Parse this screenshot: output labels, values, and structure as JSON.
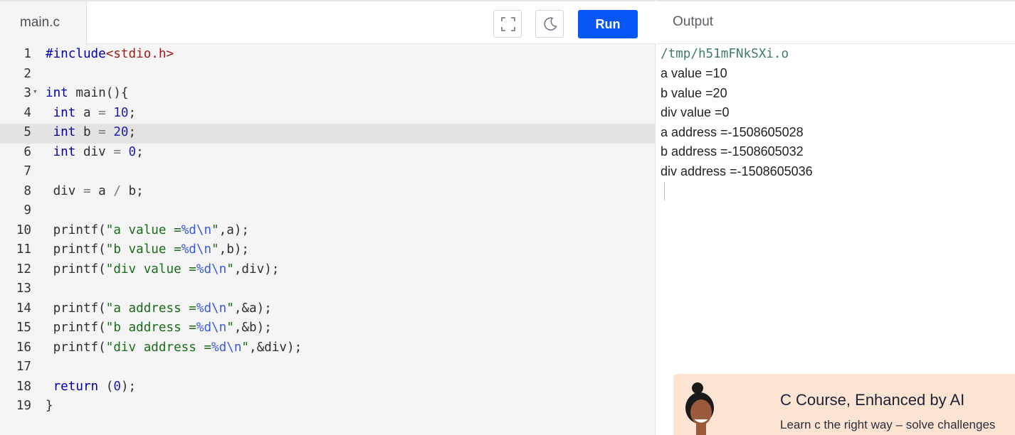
{
  "editor": {
    "file_tab": "main.c",
    "run_label": "Run",
    "active_line": 5,
    "lines": [
      {
        "n": "1",
        "segments": [
          {
            "t": "#include",
            "c": "kw"
          },
          {
            "t": "<stdio.h>",
            "c": "inc"
          }
        ]
      },
      {
        "n": "2",
        "segments": []
      },
      {
        "n": "3",
        "fold": true,
        "segments": [
          {
            "t": "int",
            "c": "kw"
          },
          {
            "t": " main(){",
            "c": ""
          }
        ]
      },
      {
        "n": "4",
        "segments": [
          {
            "t": " ",
            "c": ""
          },
          {
            "t": "int",
            "c": "kw"
          },
          {
            "t": " a ",
            "c": ""
          },
          {
            "t": "=",
            "c": "op"
          },
          {
            "t": " ",
            "c": ""
          },
          {
            "t": "10",
            "c": "num"
          },
          {
            "t": ";",
            "c": ""
          }
        ]
      },
      {
        "n": "5",
        "segments": [
          {
            "t": " ",
            "c": ""
          },
          {
            "t": "int",
            "c": "kw"
          },
          {
            "t": " b ",
            "c": ""
          },
          {
            "t": "=",
            "c": "op"
          },
          {
            "t": " ",
            "c": ""
          },
          {
            "t": "20",
            "c": "num"
          },
          {
            "t": ";",
            "c": ""
          }
        ]
      },
      {
        "n": "6",
        "segments": [
          {
            "t": " ",
            "c": ""
          },
          {
            "t": "int",
            "c": "kw"
          },
          {
            "t": " div ",
            "c": ""
          },
          {
            "t": "=",
            "c": "op"
          },
          {
            "t": " ",
            "c": ""
          },
          {
            "t": "0",
            "c": "num"
          },
          {
            "t": ";",
            "c": ""
          }
        ]
      },
      {
        "n": "7",
        "segments": []
      },
      {
        "n": "8",
        "segments": [
          {
            "t": " div ",
            "c": ""
          },
          {
            "t": "=",
            "c": "op"
          },
          {
            "t": " a ",
            "c": ""
          },
          {
            "t": "/",
            "c": "op"
          },
          {
            "t": " b;",
            "c": ""
          }
        ]
      },
      {
        "n": "9",
        "segments": []
      },
      {
        "n": "10",
        "segments": [
          {
            "t": " printf(",
            "c": ""
          },
          {
            "t": "\"a value =",
            "c": "str"
          },
          {
            "t": "%d\\n",
            "c": "fmt"
          },
          {
            "t": "\"",
            "c": "str"
          },
          {
            "t": ",a);",
            "c": ""
          }
        ]
      },
      {
        "n": "11",
        "segments": [
          {
            "t": " printf(",
            "c": ""
          },
          {
            "t": "\"b value =",
            "c": "str"
          },
          {
            "t": "%d\\n",
            "c": "fmt"
          },
          {
            "t": "\"",
            "c": "str"
          },
          {
            "t": ",b);",
            "c": ""
          }
        ]
      },
      {
        "n": "12",
        "segments": [
          {
            "t": " printf(",
            "c": ""
          },
          {
            "t": "\"div value =",
            "c": "str"
          },
          {
            "t": "%d\\n",
            "c": "fmt"
          },
          {
            "t": "\"",
            "c": "str"
          },
          {
            "t": ",div);",
            "c": ""
          }
        ]
      },
      {
        "n": "13",
        "segments": []
      },
      {
        "n": "14",
        "segments": [
          {
            "t": " printf(",
            "c": ""
          },
          {
            "t": "\"a address =",
            "c": "str"
          },
          {
            "t": "%d\\n",
            "c": "fmt"
          },
          {
            "t": "\"",
            "c": "str"
          },
          {
            "t": ",&a);",
            "c": ""
          }
        ]
      },
      {
        "n": "15",
        "segments": [
          {
            "t": " printf(",
            "c": ""
          },
          {
            "t": "\"b address =",
            "c": "str"
          },
          {
            "t": "%d\\n",
            "c": "fmt"
          },
          {
            "t": "\"",
            "c": "str"
          },
          {
            "t": ",&b);",
            "c": ""
          }
        ]
      },
      {
        "n": "16",
        "segments": [
          {
            "t": " printf(",
            "c": ""
          },
          {
            "t": "\"div address =",
            "c": "str"
          },
          {
            "t": "%d\\n",
            "c": "fmt"
          },
          {
            "t": "\"",
            "c": "str"
          },
          {
            "t": ",&div);",
            "c": ""
          }
        ]
      },
      {
        "n": "17",
        "segments": []
      },
      {
        "n": "18",
        "segments": [
          {
            "t": " ",
            "c": ""
          },
          {
            "t": "return",
            "c": "kw"
          },
          {
            "t": " (",
            "c": ""
          },
          {
            "t": "0",
            "c": "num"
          },
          {
            "t": ");",
            "c": ""
          }
        ]
      },
      {
        "n": "19",
        "segments": [
          {
            "t": "}",
            "c": ""
          }
        ]
      }
    ]
  },
  "output": {
    "header": "Output",
    "path": "/tmp/h51mFNkSXi.o",
    "lines": [
      "a value =10",
      "b value =20",
      "div value =0",
      "a address =-1508605028",
      "b address =-1508605032",
      "div address =-1508605036"
    ]
  },
  "promo": {
    "title": "C Course, Enhanced by AI",
    "subtitle": "Learn c the right way – solve challenges"
  },
  "colors": {
    "run_button": "#0556f3",
    "promo_bg": "#fde3d2",
    "active_line": "#e3e3e3"
  }
}
